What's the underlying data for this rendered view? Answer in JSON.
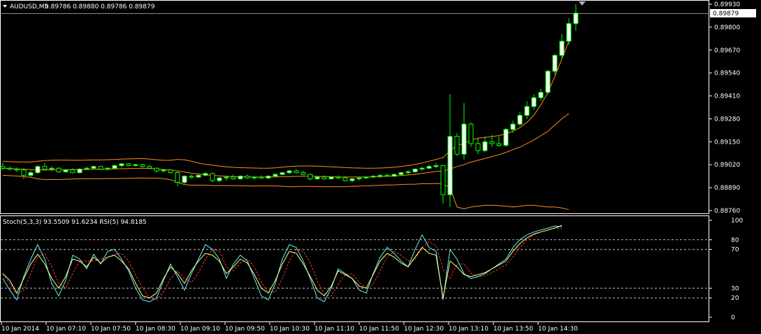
{
  "header": {
    "symbol": "AUDUSD,M5",
    "ohlc": "0.89786 0.89880 0.89786 0.89879"
  },
  "price_axis": {
    "labels": [
      "0.89930",
      "0.89800",
      "0.89670",
      "0.89540",
      "0.89410",
      "0.89280",
      "0.89150",
      "0.89020",
      "0.88890",
      "0.88760"
    ],
    "current_price": "0.89879"
  },
  "indicator": {
    "legend": "Stoch(5,3,3) 93.5509 91.6234  RSI(5) 94.8185",
    "levels": [
      "100",
      "80",
      "70",
      "30",
      "20",
      "0"
    ]
  },
  "time_axis": {
    "labels": [
      "10 Jan 2014",
      "10 Jan 07:10",
      "10 Jan 07:50",
      "10 Jan 08:30",
      "10 Jan 09:10",
      "10 Jan 09:50",
      "10 Jan 10:30",
      "10 Jan 11:10",
      "10 Jan 11:50",
      "10 Jan 12:30",
      "10 Jan 13:10",
      "10 Jan 13:50",
      "10 Jan 14:30"
    ]
  },
  "colors": {
    "background": "#000000",
    "frame": "#ffffff",
    "bull_candle": "#ffffff",
    "bear_candle": "#000000",
    "wick": "#00ff00",
    "bands": "#ff8c1a",
    "mid_band": "#ff8c1a",
    "stoch_main": "#5ff5f5",
    "stoch_signal": "#ff3030",
    "rsi": "#ffff80",
    "level_line": "#c0c0c0"
  },
  "chart_data": {
    "type": "candlestick",
    "price_range": [
      0.8874,
      0.8996
    ],
    "candles": [
      [
        0.8901,
        0.8903,
        0.8899,
        0.89
      ],
      [
        0.89,
        0.8901,
        0.88985,
        0.88995
      ],
      [
        0.88995,
        0.89005,
        0.8898,
        0.8899
      ],
      [
        0.8899,
        0.89,
        0.8894,
        0.8896
      ],
      [
        0.8896,
        0.88985,
        0.8895,
        0.88975
      ],
      [
        0.88975,
        0.8902,
        0.8897,
        0.8901
      ],
      [
        0.8901,
        0.8903,
        0.8899,
        0.88995
      ],
      [
        0.88995,
        0.8901,
        0.88985,
        0.89
      ],
      [
        0.89,
        0.89005,
        0.88975,
        0.8898
      ],
      [
        0.8898,
        0.88995,
        0.88975,
        0.8899
      ],
      [
        0.8899,
        0.89,
        0.8897,
        0.88975
      ],
      [
        0.88975,
        0.89,
        0.8897,
        0.88995
      ],
      [
        0.88995,
        0.8901,
        0.8899,
        0.89
      ],
      [
        0.89,
        0.89015,
        0.88995,
        0.8901
      ],
      [
        0.8901,
        0.89015,
        0.8899,
        0.88995
      ],
      [
        0.88995,
        0.89005,
        0.88985,
        0.89
      ],
      [
        0.89,
        0.8902,
        0.88995,
        0.89015
      ],
      [
        0.89015,
        0.8903,
        0.89005,
        0.89025
      ],
      [
        0.89025,
        0.8903,
        0.8901,
        0.89015
      ],
      [
        0.89015,
        0.89025,
        0.8901,
        0.8902
      ],
      [
        0.8902,
        0.89025,
        0.89005,
        0.8901
      ],
      [
        0.8901,
        0.8902,
        0.88995,
        0.89
      ],
      [
        0.89,
        0.89005,
        0.88975,
        0.88985
      ],
      [
        0.88985,
        0.88995,
        0.88975,
        0.8899
      ],
      [
        0.8899,
        0.88995,
        0.8897,
        0.88975
      ],
      [
        0.88975,
        0.88985,
        0.889,
        0.8892
      ],
      [
        0.8892,
        0.8896,
        0.8891,
        0.88955
      ],
      [
        0.88955,
        0.88965,
        0.8894,
        0.8895
      ],
      [
        0.8895,
        0.88965,
        0.88945,
        0.8896
      ],
      [
        0.8896,
        0.8898,
        0.88955,
        0.8897
      ],
      [
        0.8897,
        0.88975,
        0.8892,
        0.8893
      ],
      [
        0.8893,
        0.8895,
        0.8892,
        0.88945
      ],
      [
        0.88945,
        0.88955,
        0.8893,
        0.8895
      ],
      [
        0.8895,
        0.88965,
        0.88935,
        0.8894
      ],
      [
        0.8894,
        0.8896,
        0.88935,
        0.88955
      ],
      [
        0.88955,
        0.88965,
        0.8894,
        0.88945
      ],
      [
        0.88945,
        0.88955,
        0.88935,
        0.8895
      ],
      [
        0.8895,
        0.8896,
        0.8894,
        0.88945
      ],
      [
        0.88945,
        0.8896,
        0.8894,
        0.88955
      ],
      [
        0.88955,
        0.8897,
        0.8895,
        0.88965
      ],
      [
        0.88965,
        0.8898,
        0.8896,
        0.88975
      ],
      [
        0.88975,
        0.8899,
        0.88965,
        0.88985
      ],
      [
        0.88985,
        0.88995,
        0.8897,
        0.88975
      ],
      [
        0.88975,
        0.88985,
        0.8896,
        0.88965
      ],
      [
        0.88965,
        0.8897,
        0.8893,
        0.8894
      ],
      [
        0.8894,
        0.88955,
        0.88935,
        0.8895
      ],
      [
        0.8895,
        0.8896,
        0.88935,
        0.8894
      ],
      [
        0.8894,
        0.88955,
        0.88935,
        0.8895
      ],
      [
        0.8895,
        0.8896,
        0.8894,
        0.88945
      ],
      [
        0.88945,
        0.88955,
        0.88925,
        0.8893
      ],
      [
        0.8893,
        0.88945,
        0.8892,
        0.8894
      ],
      [
        0.8894,
        0.8895,
        0.8893,
        0.88945
      ],
      [
        0.88945,
        0.88955,
        0.8894,
        0.8895
      ],
      [
        0.8895,
        0.8896,
        0.88945,
        0.88955
      ],
      [
        0.88955,
        0.88965,
        0.88945,
        0.8896
      ],
      [
        0.8896,
        0.8897,
        0.8895,
        0.88955
      ],
      [
        0.88955,
        0.8897,
        0.8895,
        0.88965
      ],
      [
        0.88965,
        0.8898,
        0.8896,
        0.88975
      ],
      [
        0.88975,
        0.8899,
        0.88965,
        0.8898
      ],
      [
        0.8898,
        0.89,
        0.88975,
        0.88995
      ],
      [
        0.88995,
        0.8901,
        0.88985,
        0.89
      ],
      [
        0.89,
        0.8902,
        0.88995,
        0.8901
      ],
      [
        0.8901,
        0.8903,
        0.89,
        0.89015
      ],
      [
        0.89015,
        0.8902,
        0.888,
        0.8885
      ],
      [
        0.8885,
        0.8942,
        0.8878,
        0.8918
      ],
      [
        0.8918,
        0.892,
        0.8907,
        0.8908
      ],
      [
        0.8908,
        0.8937,
        0.8905,
        0.8925
      ],
      [
        0.8925,
        0.8926,
        0.8912,
        0.8914
      ],
      [
        0.8914,
        0.8917,
        0.8908,
        0.891
      ],
      [
        0.891,
        0.8918,
        0.8909,
        0.8915
      ],
      [
        0.8915,
        0.8919,
        0.8912,
        0.8914
      ],
      [
        0.8914,
        0.8918,
        0.8912,
        0.8913
      ],
      [
        0.8913,
        0.8923,
        0.8912,
        0.8922
      ],
      [
        0.8922,
        0.8927,
        0.892,
        0.8925
      ],
      [
        0.8925,
        0.8932,
        0.8924,
        0.893
      ],
      [
        0.893,
        0.8938,
        0.8928,
        0.8935
      ],
      [
        0.8935,
        0.8942,
        0.8933,
        0.894
      ],
      [
        0.894,
        0.8945,
        0.8938,
        0.8943
      ],
      [
        0.8943,
        0.8956,
        0.8942,
        0.8955
      ],
      [
        0.8955,
        0.8965,
        0.8953,
        0.8964
      ],
      [
        0.8964,
        0.8976,
        0.8962,
        0.8972
      ],
      [
        0.8972,
        0.8985,
        0.897,
        0.8982
      ],
      [
        0.8982,
        0.8993,
        0.8978,
        0.89879
      ]
    ],
    "mid_band": [
      0.89,
      0.88998,
      0.88996,
      0.88994,
      0.88992,
      0.8899,
      0.8899,
      0.88991,
      0.88991,
      0.88992,
      0.88992,
      0.88993,
      0.88993,
      0.88994,
      0.88994,
      0.88995,
      0.88996,
      0.88997,
      0.88998,
      0.88999,
      0.89,
      0.88998,
      0.88996,
      0.88993,
      0.8899,
      0.88985,
      0.88978,
      0.88972,
      0.88967,
      0.88963,
      0.8896,
      0.88957,
      0.88955,
      0.88953,
      0.88952,
      0.88951,
      0.8895,
      0.8895,
      0.8895,
      0.88951,
      0.88952,
      0.88953,
      0.88954,
      0.88955,
      0.88955,
      0.88954,
      0.88953,
      0.88952,
      0.88951,
      0.8895,
      0.8895,
      0.8895,
      0.8895,
      0.88951,
      0.88952,
      0.88954,
      0.88956,
      0.88959,
      0.88962,
      0.88966,
      0.88971,
      0.88976,
      0.88982,
      0.88985,
      0.88995,
      0.8901,
      0.8902,
      0.89035,
      0.89045,
      0.89055,
      0.89066,
      0.89077,
      0.8909,
      0.89105,
      0.8912,
      0.8914,
      0.8916,
      0.89185,
      0.8921,
      0.89245,
      0.8928,
      0.8931
    ],
    "upper_band": [
      0.8904,
      0.89038,
      0.89036,
      0.89036,
      0.89035,
      0.8904,
      0.89044,
      0.89045,
      0.89046,
      0.89046,
      0.89045,
      0.89045,
      0.89046,
      0.89047,
      0.89047,
      0.89048,
      0.8905,
      0.89052,
      0.89053,
      0.89054,
      0.89055,
      0.89052,
      0.89048,
      0.89045,
      0.89045,
      0.8905,
      0.89048,
      0.8904,
      0.8903,
      0.89022,
      0.89018,
      0.89012,
      0.89008,
      0.89005,
      0.89003,
      0.89002,
      0.89001,
      0.89,
      0.89,
      0.89002,
      0.89006,
      0.8901,
      0.89012,
      0.89013,
      0.89013,
      0.89012,
      0.8901,
      0.89008,
      0.89006,
      0.89004,
      0.89002,
      0.89001,
      0.89,
      0.89,
      0.89001,
      0.89003,
      0.89006,
      0.8901,
      0.89015,
      0.89022,
      0.8903,
      0.8904,
      0.8905,
      0.8906,
      0.891,
      0.8913,
      0.8914,
      0.8916,
      0.8917,
      0.89175,
      0.8918,
      0.89185,
      0.89195,
      0.8921,
      0.8923,
      0.8926,
      0.893,
      0.8936,
      0.8943,
      0.8952,
      0.8962,
      0.8972
    ],
    "lower_band": [
      0.8896,
      0.88958,
      0.88956,
      0.88952,
      0.88949,
      0.8894,
      0.88936,
      0.88937,
      0.88936,
      0.88938,
      0.88939,
      0.88941,
      0.8894,
      0.88941,
      0.88941,
      0.88942,
      0.88942,
      0.88942,
      0.88943,
      0.88944,
      0.88945,
      0.88944,
      0.88944,
      0.88941,
      0.88935,
      0.8892,
      0.88908,
      0.88904,
      0.88904,
      0.88904,
      0.88902,
      0.88902,
      0.88902,
      0.88901,
      0.88901,
      0.889,
      0.88899,
      0.889,
      0.889,
      0.889,
      0.88898,
      0.88896,
      0.88896,
      0.88897,
      0.88897,
      0.88896,
      0.88896,
      0.88896,
      0.88896,
      0.88896,
      0.88898,
      0.88899,
      0.889,
      0.88902,
      0.88903,
      0.88905,
      0.88906,
      0.88908,
      0.88909,
      0.8891,
      0.88912,
      0.88912,
      0.88914,
      0.8891,
      0.8889,
      0.8878,
      0.8877,
      0.8878,
      0.88785,
      0.8879,
      0.8879,
      0.88788,
      0.88785,
      0.8878,
      0.88785,
      0.8879,
      0.8879,
      0.88785,
      0.8878,
      0.8878,
      0.88775,
      0.88765
    ],
    "stoch_main": [
      40,
      28,
      18,
      42,
      60,
      75,
      60,
      35,
      22,
      38,
      64,
      60,
      50,
      65,
      55,
      68,
      70,
      60,
      48,
      30,
      18,
      16,
      20,
      38,
      55,
      42,
      28,
      45,
      60,
      75,
      70,
      60,
      40,
      55,
      64,
      58,
      40,
      22,
      18,
      35,
      60,
      75,
      72,
      58,
      40,
      20,
      16,
      30,
      50,
      45,
      40,
      28,
      25,
      45,
      62,
      72,
      66,
      58,
      52,
      70,
      85,
      72,
      68,
      18,
      70,
      60,
      45,
      40,
      42,
      45,
      50,
      55,
      60,
      72,
      80,
      85,
      88,
      90,
      92,
      94,
      93.55
    ],
    "stoch_signal": [
      45,
      35,
      24,
      28,
      45,
      62,
      66,
      52,
      35,
      30,
      45,
      58,
      58,
      58,
      60,
      62,
      65,
      66,
      58,
      44,
      30,
      20,
      18,
      26,
      40,
      48,
      40,
      36,
      46,
      60,
      70,
      68,
      52,
      48,
      56,
      60,
      52,
      36,
      26,
      26,
      40,
      58,
      70,
      68,
      56,
      38,
      24,
      22,
      34,
      44,
      45,
      36,
      30,
      34,
      48,
      62,
      68,
      64,
      58,
      60,
      72,
      78,
      74,
      50,
      40,
      55,
      55,
      45,
      42,
      43,
      46,
      50,
      54,
      62,
      72,
      80,
      85,
      88,
      90,
      92,
      91.62
    ],
    "rsi": [
      45,
      38,
      25,
      40,
      55,
      65,
      55,
      40,
      30,
      42,
      60,
      58,
      52,
      62,
      56,
      62,
      64,
      58,
      50,
      35,
      22,
      20,
      25,
      40,
      52,
      45,
      35,
      48,
      58,
      66,
      64,
      58,
      45,
      52,
      60,
      56,
      44,
      30,
      25,
      38,
      55,
      68,
      66,
      55,
      42,
      28,
      22,
      32,
      48,
      44,
      40,
      32,
      30,
      44,
      58,
      66,
      62,
      56,
      52,
      62,
      72,
      66,
      64,
      20,
      58,
      52,
      44,
      42,
      44,
      46,
      50,
      54,
      58,
      68,
      76,
      82,
      86,
      88,
      90,
      92,
      94.82
    ],
    "indicator_levels": [
      100,
      80,
      70,
      30,
      20,
      0
    ]
  }
}
